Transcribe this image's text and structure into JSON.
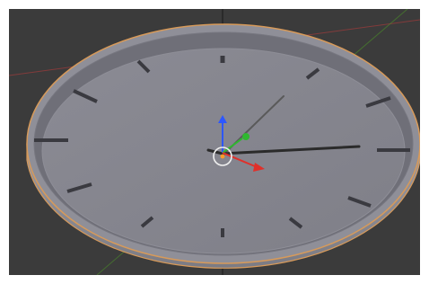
{
  "viewport": {
    "background_color": "#3b3b3b",
    "grid_axis_colors": {
      "x_axis": "#a83b3b",
      "y_axis": "#4a8a2a",
      "z_axis": "#111111"
    }
  },
  "object": {
    "type": "clock-face",
    "selected_outline_color": "#d79a5a",
    "rim_outer_color": "#8b8b94",
    "rim_inner_color": "#6c6c74",
    "face_color": "#8f8f98"
  },
  "clock": {
    "hour_markers_count": 12,
    "hands": [
      {
        "name": "hour-hand",
        "color": "#2b2b2b"
      },
      {
        "name": "minute-hand",
        "color": "#2b2b2b"
      },
      {
        "name": "second-hand",
        "color": "#5a5a5a"
      }
    ]
  },
  "gizmo": {
    "x_color": "#e0302a",
    "y_color": "#2fb82f",
    "z_color": "#2d57ff",
    "pivot_icon": "3d-cursor-icon"
  }
}
